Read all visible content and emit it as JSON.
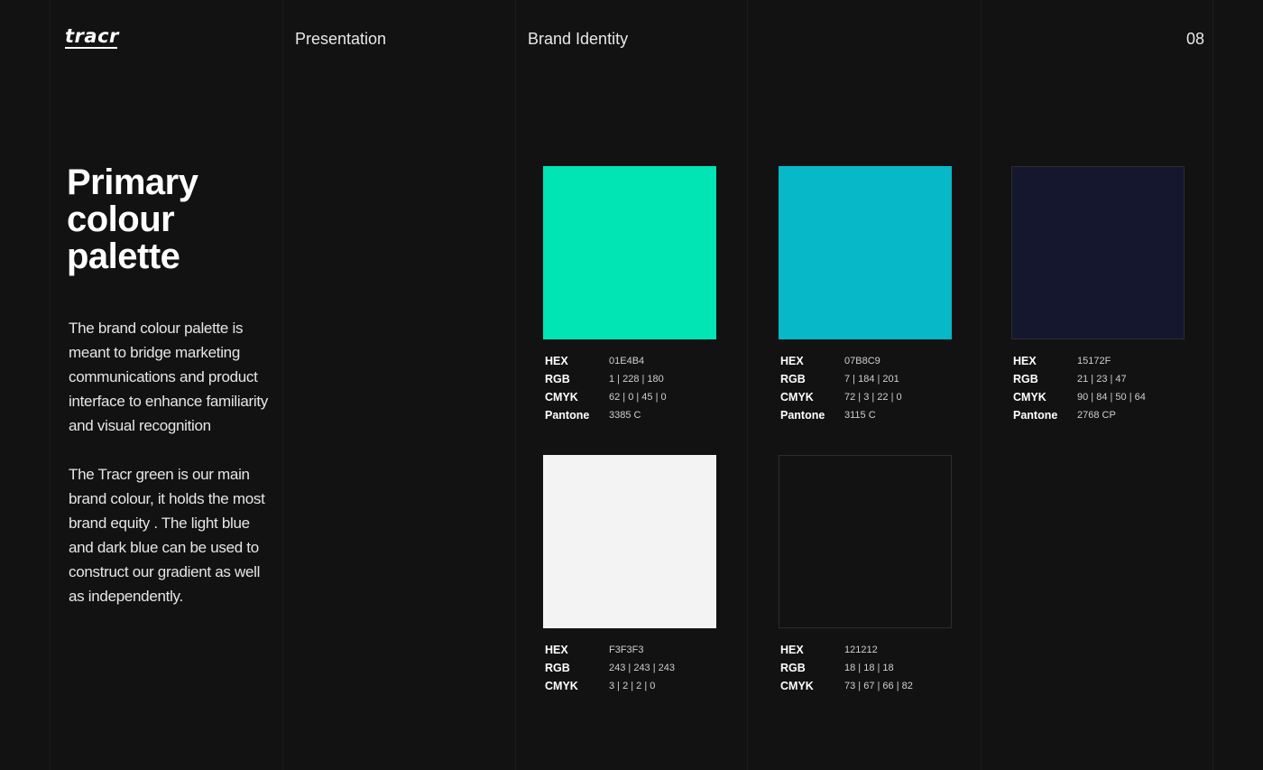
{
  "header": {
    "logo_text": "tracr",
    "section": "Presentation",
    "topic": "Brand Identity",
    "page_number": "08"
  },
  "intro": {
    "title_lines": [
      "Primary",
      "colour",
      "palette"
    ],
    "paragraph_1": "The brand colour palette is meant to bridge marketing communications and product interface to enhance familiarity and visual recognition",
    "paragraph_2": "The Tracr green is our main brand colour, it holds the most brand equity . The light blue and dark blue can be used to construct our gradient as well as independently."
  },
  "labels": {
    "hex": "HEX",
    "rgb": "RGB",
    "cmyk": "CMYK",
    "pantone": "Pantone"
  },
  "swatches": [
    {
      "color": "#01E4B4",
      "hex": "01E4B4",
      "rgb": "1 | 228 | 180",
      "cmyk": "62 | 0 | 45 | 0",
      "pantone": "3385 C"
    },
    {
      "color": "#07B8C9",
      "hex": "07B8C9",
      "rgb": "7 | 184 | 201",
      "cmyk": "72 | 3 | 22 | 0",
      "pantone": "3115 C"
    },
    {
      "color": "#15172F",
      "hex": "15172F",
      "rgb": "21 | 23 | 47",
      "cmyk": "90 | 84 | 50 | 64",
      "pantone": "2768 CP"
    },
    {
      "color": "#F3F3F3",
      "hex": "F3F3F3",
      "rgb": "243 | 243 | 243",
      "cmyk": "3 | 2 | 2 | 0"
    },
    {
      "color": "#121212",
      "hex": "121212",
      "rgb": "18 | 18 | 18",
      "cmyk": "73 | 67 | 66 | 82"
    }
  ]
}
